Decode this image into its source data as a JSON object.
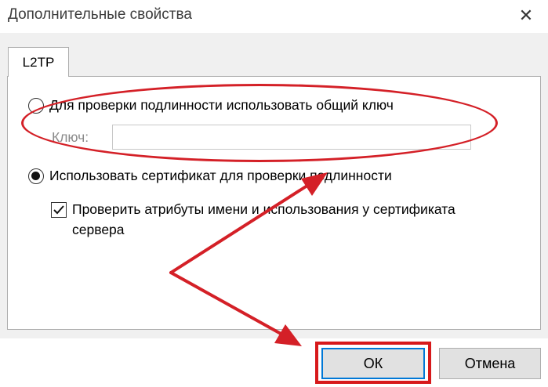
{
  "window": {
    "title": "Дополнительные свойства",
    "close_glyph": "✕"
  },
  "tabs": [
    {
      "label": "L2TP"
    }
  ],
  "auth": {
    "psk_option_label": "Для проверки подлинности использовать общий ключ",
    "key_label": "Ключ:",
    "key_value": "",
    "cert_option_label": "Использовать сертификат для проверки подлинности",
    "verify_checkbox_label_line1": "Проверить атрибуты имени и использования у сертификата",
    "verify_checkbox_label_line2": "сервера",
    "selected_option": "certificate",
    "verify_checked": true
  },
  "buttons": {
    "ok_label": "ОК",
    "cancel_label": "Отмена"
  },
  "annotation_colors": {
    "highlight": "#d7191b",
    "arrow": "#d42027"
  }
}
